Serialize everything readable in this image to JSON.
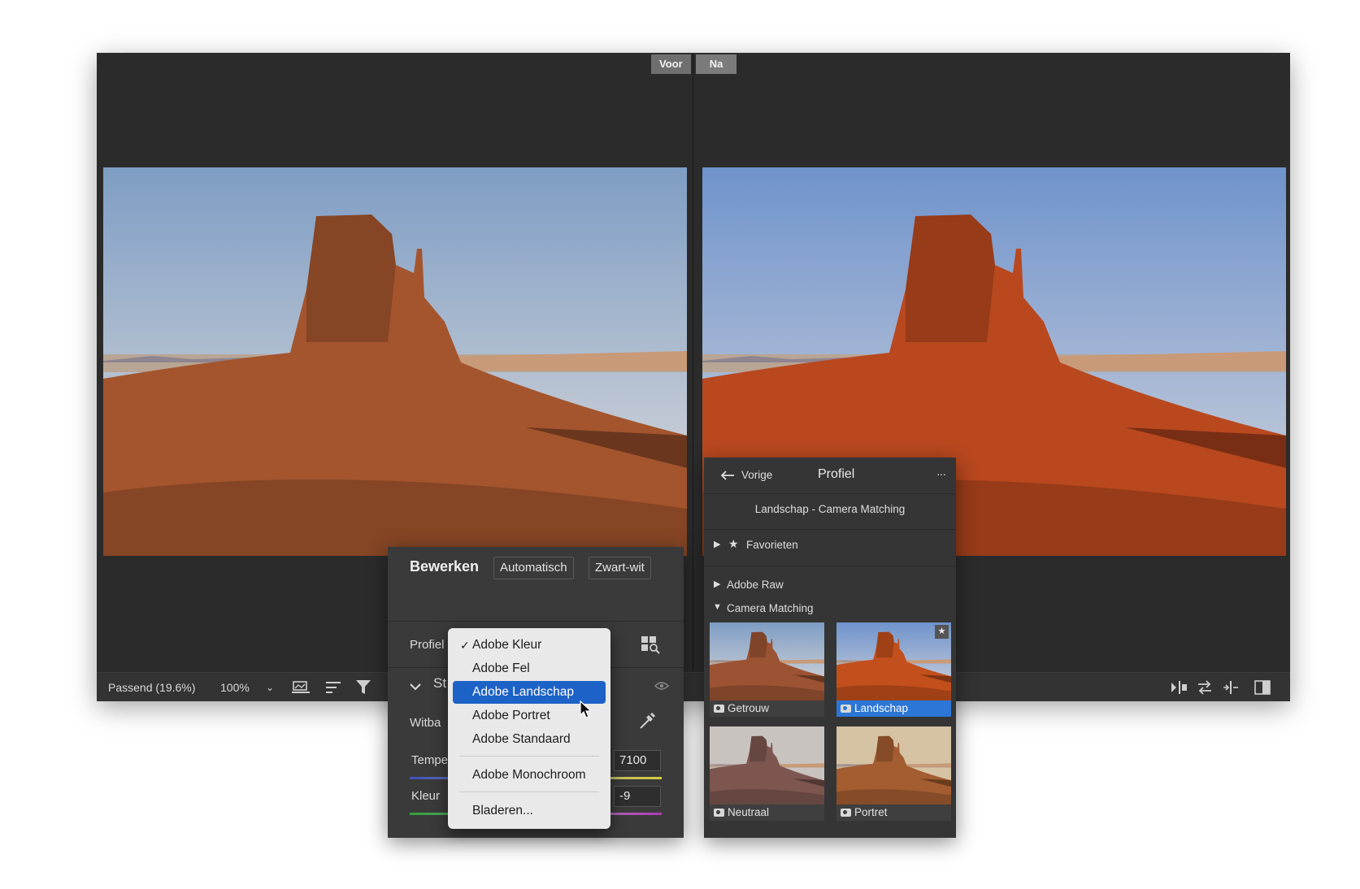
{
  "compare": {
    "before_label": "Voor",
    "after_label": "Na"
  },
  "toolbar": {
    "fit_label": "Passend (19.6%)",
    "zoom_label": "100%",
    "zoom_arrow": "⌄",
    "filmstrip_icon": "filmstrip-icon",
    "sort_icon": "sort-icon",
    "filter_icon": "filter-icon",
    "swap_icons": [
      "copy-before-after-icon",
      "swap-icon",
      "copy-after-before-icon",
      "toggle-view-icon"
    ]
  },
  "edit_panel": {
    "title": "Bewerken",
    "auto_label": "Automatisch",
    "bw_label": "Zwart-wit",
    "profile_label": "Profiel",
    "section_label": "St",
    "wb_label": "Witba",
    "temp_label": "Tempe",
    "temp_value": "7100",
    "tint_label": "Kleur",
    "tint_value": "-9"
  },
  "dropdown": {
    "check": "✓",
    "items": [
      "Adobe Kleur",
      "Adobe Fel",
      "Adobe Landschap",
      "Adobe Portret",
      "Adobe Standaard",
      "Adobe Monochroom",
      "Bladeren..."
    ],
    "selected": "Adobe Landschap"
  },
  "profile_panel": {
    "back_label": "Vorige",
    "title": "Profiel",
    "more": "···",
    "current_profile": "Landschap - Camera Matching",
    "groups": [
      "Favorieten",
      "Adobe Raw",
      "Camera Matching"
    ],
    "thumbs": [
      "Getrouw",
      "Landschap",
      "Neutraal",
      "Portret"
    ],
    "selected_thumb": "Landschap"
  },
  "colors": {
    "accent": "#1d62c6",
    "selected_thumb": "#2c76d6",
    "panel_bg": "#3a3a3a",
    "window_bg": "#2b2b2b"
  }
}
